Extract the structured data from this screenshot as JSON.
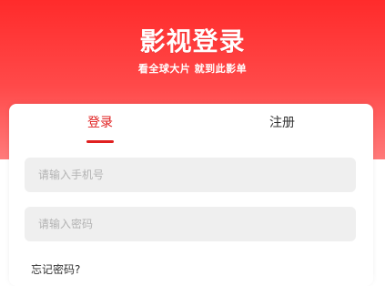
{
  "header": {
    "title": "影视登录",
    "subtitle": "看全球大片 就到此影单"
  },
  "tabs": {
    "login": "登录",
    "register": "注册",
    "active": "login"
  },
  "form": {
    "phone_placeholder": "请输入手机号",
    "password_placeholder": "请输入密码",
    "forgot_password": "忘记密码?"
  },
  "colors": {
    "brand_red": "#ff2b2b",
    "active_tab": "#e02020",
    "input_bg": "#efefef",
    "placeholder": "#b3b3b3"
  }
}
